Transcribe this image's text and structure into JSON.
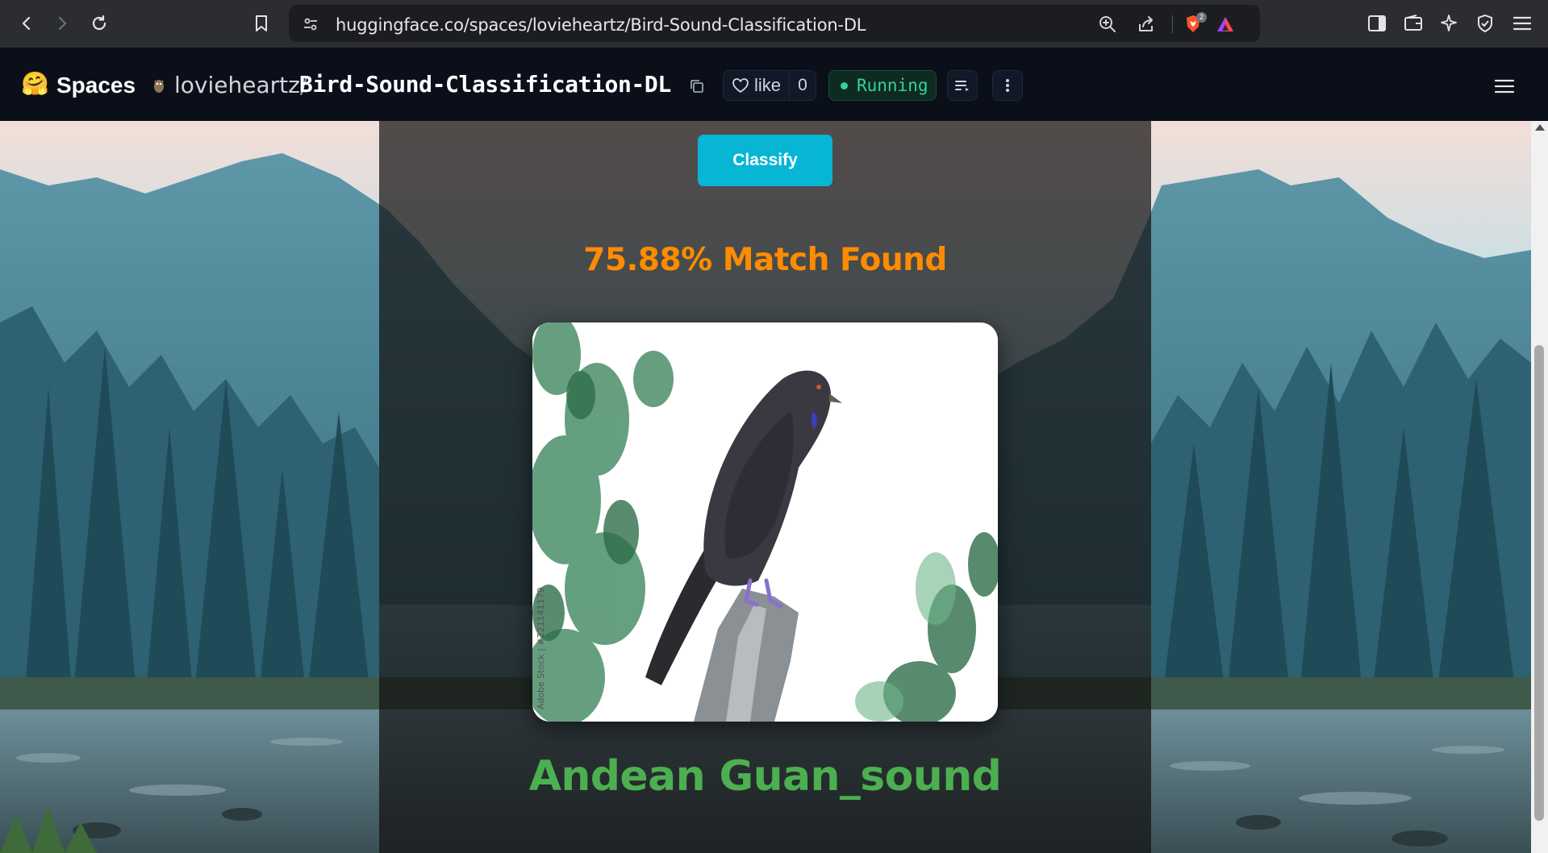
{
  "browser": {
    "url": "huggingface.co/spaces/lovieheartz/Bird-Sound-Classification-DL",
    "brave_badge_count": "2"
  },
  "header": {
    "logo": "🤗",
    "spaces_label": "Spaces",
    "owner": "lovieheartz",
    "separator": "/",
    "repo": "Bird-Sound-Classification-DL",
    "like_label": "like",
    "like_count": "0",
    "status": "Running"
  },
  "main": {
    "classify_label": "Classify",
    "match_text": "75.88% Match Found",
    "bird_name": "Andean Guan_sound",
    "watermark": "Adobe Stock | #221141179"
  },
  "colors": {
    "accent_button": "#06b6d4",
    "match_text": "#ff8c00",
    "bird_name": "#4caf50",
    "status": "#34d399"
  }
}
